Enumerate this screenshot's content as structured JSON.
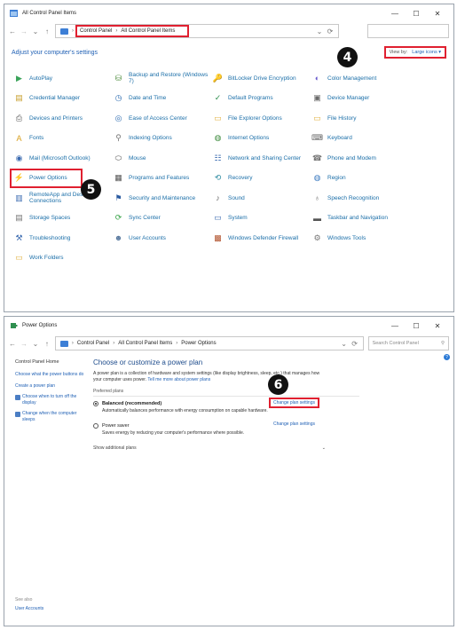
{
  "win1": {
    "title": "All Control Panel Items",
    "controls": {
      "minimize": "—",
      "maximize": "☐",
      "close": "✕"
    },
    "nav": {
      "back": "←",
      "forward": "→",
      "history": "⌄",
      "up": "↑"
    },
    "breadcrumb": [
      "Control Panel",
      "All Control Panel Items"
    ],
    "breadcrumb_sep": "›",
    "dropdown": "⌄",
    "refresh": "⟳",
    "heading": "Adjust your computer's settings",
    "view_by_label": "View by:",
    "view_by_value": "Large icons ▾",
    "marker": "4",
    "items": [
      {
        "label": "AutoPlay",
        "icon": "autoplay-icon",
        "glyph": "▶",
        "color": "#3aa35a"
      },
      {
        "label": "Backup and Restore (Windows 7)",
        "icon": "backup-icon",
        "glyph": "⛁",
        "color": "#4a8a3a"
      },
      {
        "label": "BitLocker Drive Encryption",
        "icon": "bitlocker-icon",
        "glyph": "🔑",
        "color": "#888888"
      },
      {
        "label": "Color Management",
        "icon": "color-management-icon",
        "glyph": "◐",
        "color": "#6a5acd"
      },
      {
        "label": "Credential Manager",
        "icon": "credential-icon",
        "glyph": "▤",
        "color": "#c8a030"
      },
      {
        "label": "Date and Time",
        "icon": "clock-icon",
        "glyph": "◷",
        "color": "#2a6ab0"
      },
      {
        "label": "Default Programs",
        "icon": "default-programs-icon",
        "glyph": "✓",
        "color": "#2f8f4f"
      },
      {
        "label": "Device Manager",
        "icon": "device-manager-icon",
        "glyph": "▣",
        "color": "#6a6a6a"
      },
      {
        "label": "Devices and Printers",
        "icon": "printer-icon",
        "glyph": "⎙",
        "color": "#5a5a5a"
      },
      {
        "label": "Ease of Access Center",
        "icon": "ease-of-access-icon",
        "glyph": "◎",
        "color": "#2a6ab0"
      },
      {
        "label": "File Explorer Options",
        "icon": "folder-options-icon",
        "glyph": "▭",
        "color": "#e0b040"
      },
      {
        "label": "File History",
        "icon": "file-history-icon",
        "glyph": "▭",
        "color": "#e0b040"
      },
      {
        "label": "Fonts",
        "icon": "fonts-icon",
        "glyph": "A",
        "color": "#d8a020"
      },
      {
        "label": "Indexing Options",
        "icon": "indexing-icon",
        "glyph": "⚲",
        "color": "#777777"
      },
      {
        "label": "Internet Options",
        "icon": "internet-icon",
        "glyph": "◍",
        "color": "#3a8a3a"
      },
      {
        "label": "Keyboard",
        "icon": "keyboard-icon",
        "glyph": "⌨",
        "color": "#666666"
      },
      {
        "label": "Mail (Microsoft Outlook)",
        "icon": "mail-icon",
        "glyph": "◉",
        "color": "#3a6ab0"
      },
      {
        "label": "Mouse",
        "icon": "mouse-icon",
        "glyph": "⬭",
        "color": "#555555"
      },
      {
        "label": "Network and Sharing Center",
        "icon": "network-icon",
        "glyph": "☷",
        "color": "#3a6ab0"
      },
      {
        "label": "Phone and Modem",
        "icon": "phone-icon",
        "glyph": "☎",
        "color": "#777777"
      },
      {
        "label": "Power Options",
        "icon": "power-options-icon",
        "glyph": "⚡",
        "color": "#2f8f4f"
      },
      {
        "label": "Programs and Features",
        "icon": "programs-icon",
        "glyph": "▦",
        "color": "#555555"
      },
      {
        "label": "Recovery",
        "icon": "recovery-icon",
        "glyph": "⟲",
        "color": "#2a8aa0"
      },
      {
        "label": "Region",
        "icon": "region-icon",
        "glyph": "◍",
        "color": "#3a7ac0"
      },
      {
        "label": "RemoteApp and Desktop Connections",
        "icon": "remoteapp-icon",
        "glyph": "▥",
        "color": "#3a6ab0"
      },
      {
        "label": "Security and Maintenance",
        "icon": "flag-icon",
        "glyph": "⚑",
        "color": "#2a5aa0"
      },
      {
        "label": "Sound",
        "icon": "sound-icon",
        "glyph": "♪",
        "color": "#666666"
      },
      {
        "label": "Speech Recognition",
        "icon": "microphone-icon",
        "glyph": "♁",
        "color": "#777777"
      },
      {
        "label": "Storage Spaces",
        "icon": "storage-icon",
        "glyph": "▤",
        "color": "#777777"
      },
      {
        "label": "Sync Center",
        "icon": "sync-icon",
        "glyph": "⟳",
        "color": "#2f9f3f"
      },
      {
        "label": "System",
        "icon": "system-icon",
        "glyph": "▭",
        "color": "#3a6ab0"
      },
      {
        "label": "Taskbar and Navigation",
        "icon": "taskbar-icon",
        "glyph": "▬",
        "color": "#555555"
      },
      {
        "label": "Troubleshooting",
        "icon": "troubleshooting-icon",
        "glyph": "⚒",
        "color": "#3a6ab0"
      },
      {
        "label": "User Accounts",
        "icon": "user-accounts-icon",
        "glyph": "☻",
        "color": "#5a7aa0"
      },
      {
        "label": "Windows Defender Firewall",
        "icon": "firewall-icon",
        "glyph": "▩",
        "color": "#b0502a"
      },
      {
        "label": "Windows Tools",
        "icon": "tools-icon",
        "glyph": "⚙",
        "color": "#777777"
      },
      {
        "label": "Work Folders",
        "icon": "work-folders-icon",
        "glyph": "▭",
        "color": "#e0b040"
      }
    ],
    "marker5": "5"
  },
  "win2": {
    "title": "Power Options",
    "controls": {
      "minimize": "—",
      "maximize": "☐",
      "close": "✕"
    },
    "nav": {
      "back": "←",
      "forward": "→",
      "history": "⌄",
      "up": "↑"
    },
    "breadcrumb": [
      "Control Panel",
      "All Control Panel Items",
      "Power Options"
    ],
    "breadcrumb_sep": "›",
    "dropdown": "⌄",
    "refresh": "⟳",
    "search_placeholder": "Search Control Panel",
    "search_icon": "⚲",
    "help": "?",
    "sidebar": {
      "home": "Control Panel Home",
      "links": [
        {
          "label": "Choose what the power buttons do",
          "shield": false
        },
        {
          "label": "Create a power plan",
          "shield": false
        },
        {
          "label": "Choose when to turn off the display",
          "shield": true
        },
        {
          "label": "Change when the computer sleeps",
          "shield": true
        }
      ],
      "see_also": "See also",
      "user_accounts": "User Accounts"
    },
    "heading": "Choose or customize a power plan",
    "description": "A power plan is a collection of hardware and system settings (like display brightness, sleep, etc.) that manages how your computer uses power.",
    "description_link": "Tell me more about power plans",
    "preferred_plans": "Preferred plans",
    "plans": [
      {
        "name": "Balanced (recommended)",
        "desc": "Automatically balances performance with energy consumption on capable hardware.",
        "action": "Change plan settings",
        "selected": true
      },
      {
        "name": "Power saver",
        "desc": "Saves energy by reducing your computer's performance where possible.",
        "action": "Change plan settings",
        "selected": false
      }
    ],
    "show_additional": "Show additional plans",
    "chevron": "⌄",
    "marker": "6"
  }
}
